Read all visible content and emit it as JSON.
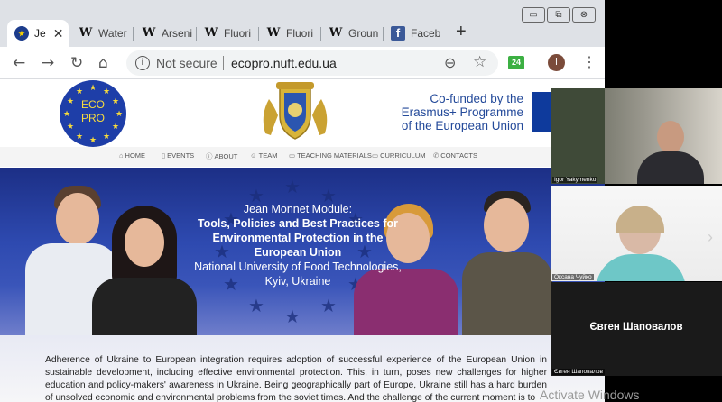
{
  "browser": {
    "tabs": [
      {
        "title": "Je",
        "favicon": "eu"
      },
      {
        "title": "Water",
        "favicon": "W"
      },
      {
        "title": "Arseni",
        "favicon": "W"
      },
      {
        "title": "Fluori",
        "favicon": "W"
      },
      {
        "title": "Fluori",
        "favicon": "W"
      },
      {
        "title": "Groun",
        "favicon": "W"
      },
      {
        "title": "Faceb",
        "favicon": "f"
      }
    ],
    "security_label": "Not secure",
    "url": "ecopro.nuft.edu.ua",
    "extension_badge": "24",
    "profile_initial": "i"
  },
  "site": {
    "logo_text_1": "ECO",
    "logo_text_2": "PRO",
    "cofunded_lines": [
      "Co-funded by the",
      "Erasmus+ Programme",
      "of the European Union"
    ],
    "nav": [
      {
        "label": "HOME",
        "icon": "home-icon"
      },
      {
        "label": "EVENTS",
        "icon": "bookmark-icon"
      },
      {
        "label": "ABOUT",
        "icon": "info-icon"
      },
      {
        "label": "TEAM",
        "icon": "team-icon"
      },
      {
        "label": "TEACHING MATERIALS",
        "icon": "book-icon"
      },
      {
        "label": "CURRICULUM",
        "icon": "folder-icon"
      },
      {
        "label": "CONTACTS",
        "icon": "phone-icon"
      }
    ],
    "hero": {
      "line1": "Jean Monnet Module:",
      "title": "Tools, Policies and Best Practices for Environmental Protection in the European Union",
      "institution": "National University of Food Technologies,",
      "city": "Kyiv, Ukraine"
    },
    "article_text": "Adherence of Ukraine to European integration requires adoption of successful experience of the European Union in sustainable development, including effective environmental protection. This, in turn, poses new challenges for higher education and policy-makers' awareness in Ukraine. Being geographically part of Europe, Ukraine still has a hard burden of unsolved economic and environmental problems from the soviet times. And the challenge of the current moment is to"
  },
  "video_call": {
    "participants": [
      {
        "name": "Igor Yakymenko"
      },
      {
        "name": "Оксана Чуйко"
      },
      {
        "name": "Євген Шаповалов",
        "display_name": "Євген Шаповалов"
      }
    ]
  },
  "os": {
    "watermark": "Activate Windows"
  },
  "colors": {
    "eu_blue": "#1e3ea8",
    "eu_yellow": "#f8dc3c",
    "cofund_text": "#244a9a"
  }
}
